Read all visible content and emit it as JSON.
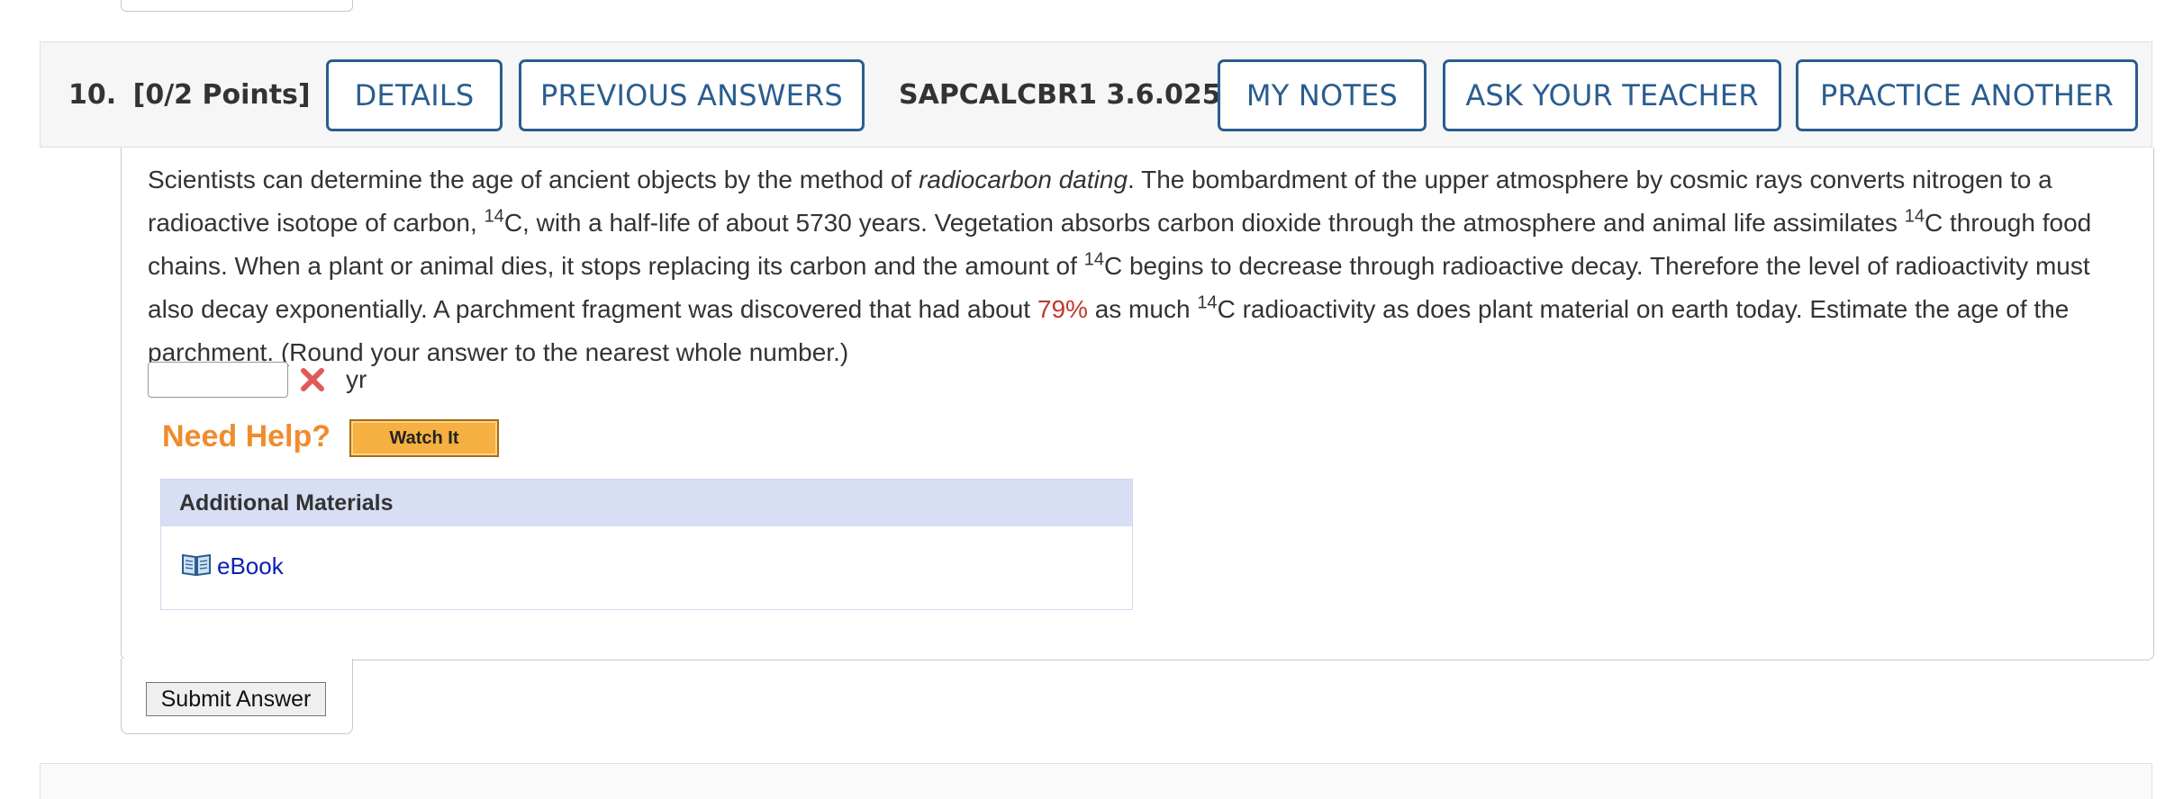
{
  "question": {
    "number_label": "10.",
    "points_label": "[0/2 Points]",
    "code": "SAPCALCBR1 3.6.025.",
    "buttons": {
      "details": "DETAILS",
      "previous_answers": "PREVIOUS ANSWERS",
      "my_notes": "MY NOTES",
      "ask_teacher": "ASK YOUR TEACHER",
      "practice_another": "PRACTICE ANOTHER"
    }
  },
  "problem": {
    "t1": "Scientists can determine the age of ancient objects by the method of ",
    "t1_em": "radiocarbon dating",
    "t2": ". The bombardment of the upper atmosphere by cosmic rays converts nitrogen to a radioactive isotope of carbon, ",
    "sup": "14",
    "t3": "C, with a half-life of about 5730 years. Vegetation absorbs carbon dioxide through the atmosphere and animal life assimilates ",
    "t4": "C through food chains. When a plant or animal dies, it stops replacing its carbon and the amount of ",
    "t5": "C begins to decrease through radioactive decay. Therefore the level of radioactivity must also decay exponentially. A parchment fragment was discovered that had about ",
    "percent": "79%",
    "t6": " as much ",
    "t7": "C radioactivity as does plant material on earth today. Estimate the age of the parchment. (Round your answer to the nearest whole number.)"
  },
  "answer": {
    "value": "",
    "unit": "yr",
    "status_icon": "x-mark-icon"
  },
  "help": {
    "label": "Need Help?",
    "watch_button": "Watch It"
  },
  "additional_materials": {
    "title": "Additional Materials",
    "items": [
      {
        "icon": "book-icon",
        "label": "eBook"
      }
    ]
  },
  "submit": {
    "label": "Submit Answer"
  },
  "colors": {
    "button_border": "#2a5d8f",
    "highlight_red": "#c0392b",
    "help_orange": "#f08c2e",
    "link_blue": "#0a1fb3",
    "error_red": "#e05a5a"
  }
}
